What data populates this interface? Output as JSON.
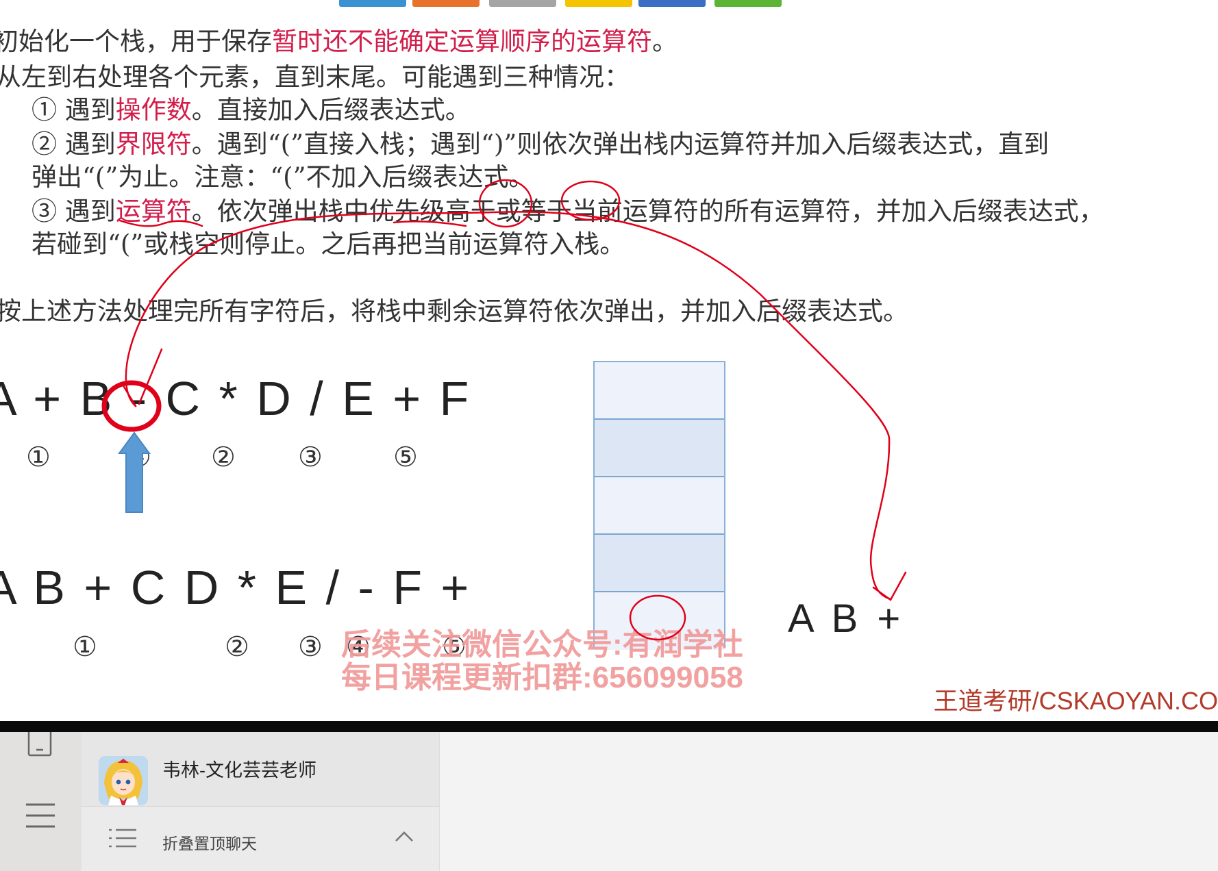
{
  "slide": {
    "line1_prefix": "初始化一个栈，用于保存",
    "line1_highlight": "暂时还不能确定运算顺序的运算符",
    "line1_suffix": "。",
    "line2": "从左到右处理各个元素，直到末尾。可能遇到三种情况：",
    "item1_prefix": "① 遇到",
    "item1_highlight": "操作数",
    "item1_suffix": "。直接加入后缀表达式。",
    "item2_prefix": "② 遇到",
    "item2_highlight": "界限符",
    "item2_suffix": "。遇到“(”直接入栈；遇到“)”则依次弹出栈内运算符并加入后缀表达式，直到",
    "item2_line2": "弹出“(”为止。注意：“(”不加入后缀表达式。",
    "item3_prefix": "③ 遇到",
    "item3_highlight": "运算符",
    "item3_suffix": "。依次弹出栈中优先级高于或等于当前运算符的所有运算符，并加入后缀表达式，",
    "item3_line2": "若碰到“(”或栈空则停止。之后再把当前运算符入栈。",
    "final_line": "按上述方法处理完所有字符后，将栈中剩余运算符依次弹出，并加入后缀表达式。",
    "infix_expression": "A + B - C * D / E + F",
    "infix_order": [
      "①",
      "④",
      "②",
      "③",
      "⑤"
    ],
    "postfix_expression": "A B + C D * E / - F +",
    "postfix_order": [
      "①",
      "②",
      "③",
      "④",
      "⑤"
    ],
    "current_output": "A B +",
    "stack_cells": 5,
    "watermark_line1": "后续关注微信公众号:有润学社",
    "watermark_line2": "每日课程更新扣群:656099058",
    "brand": "王道考研/CSKAOYAN.COM",
    "colors": {
      "highlight": "#d21e4b",
      "annotation": "#e0001a",
      "arrow": "#5b9bd5"
    }
  },
  "chat": {
    "contact_name": "韦林-文化芸芸老师",
    "folded_label": "折叠置顶聊天",
    "icons": [
      "phone-icon",
      "menu-icon",
      "list-icon",
      "chevron-up-icon"
    ]
  }
}
